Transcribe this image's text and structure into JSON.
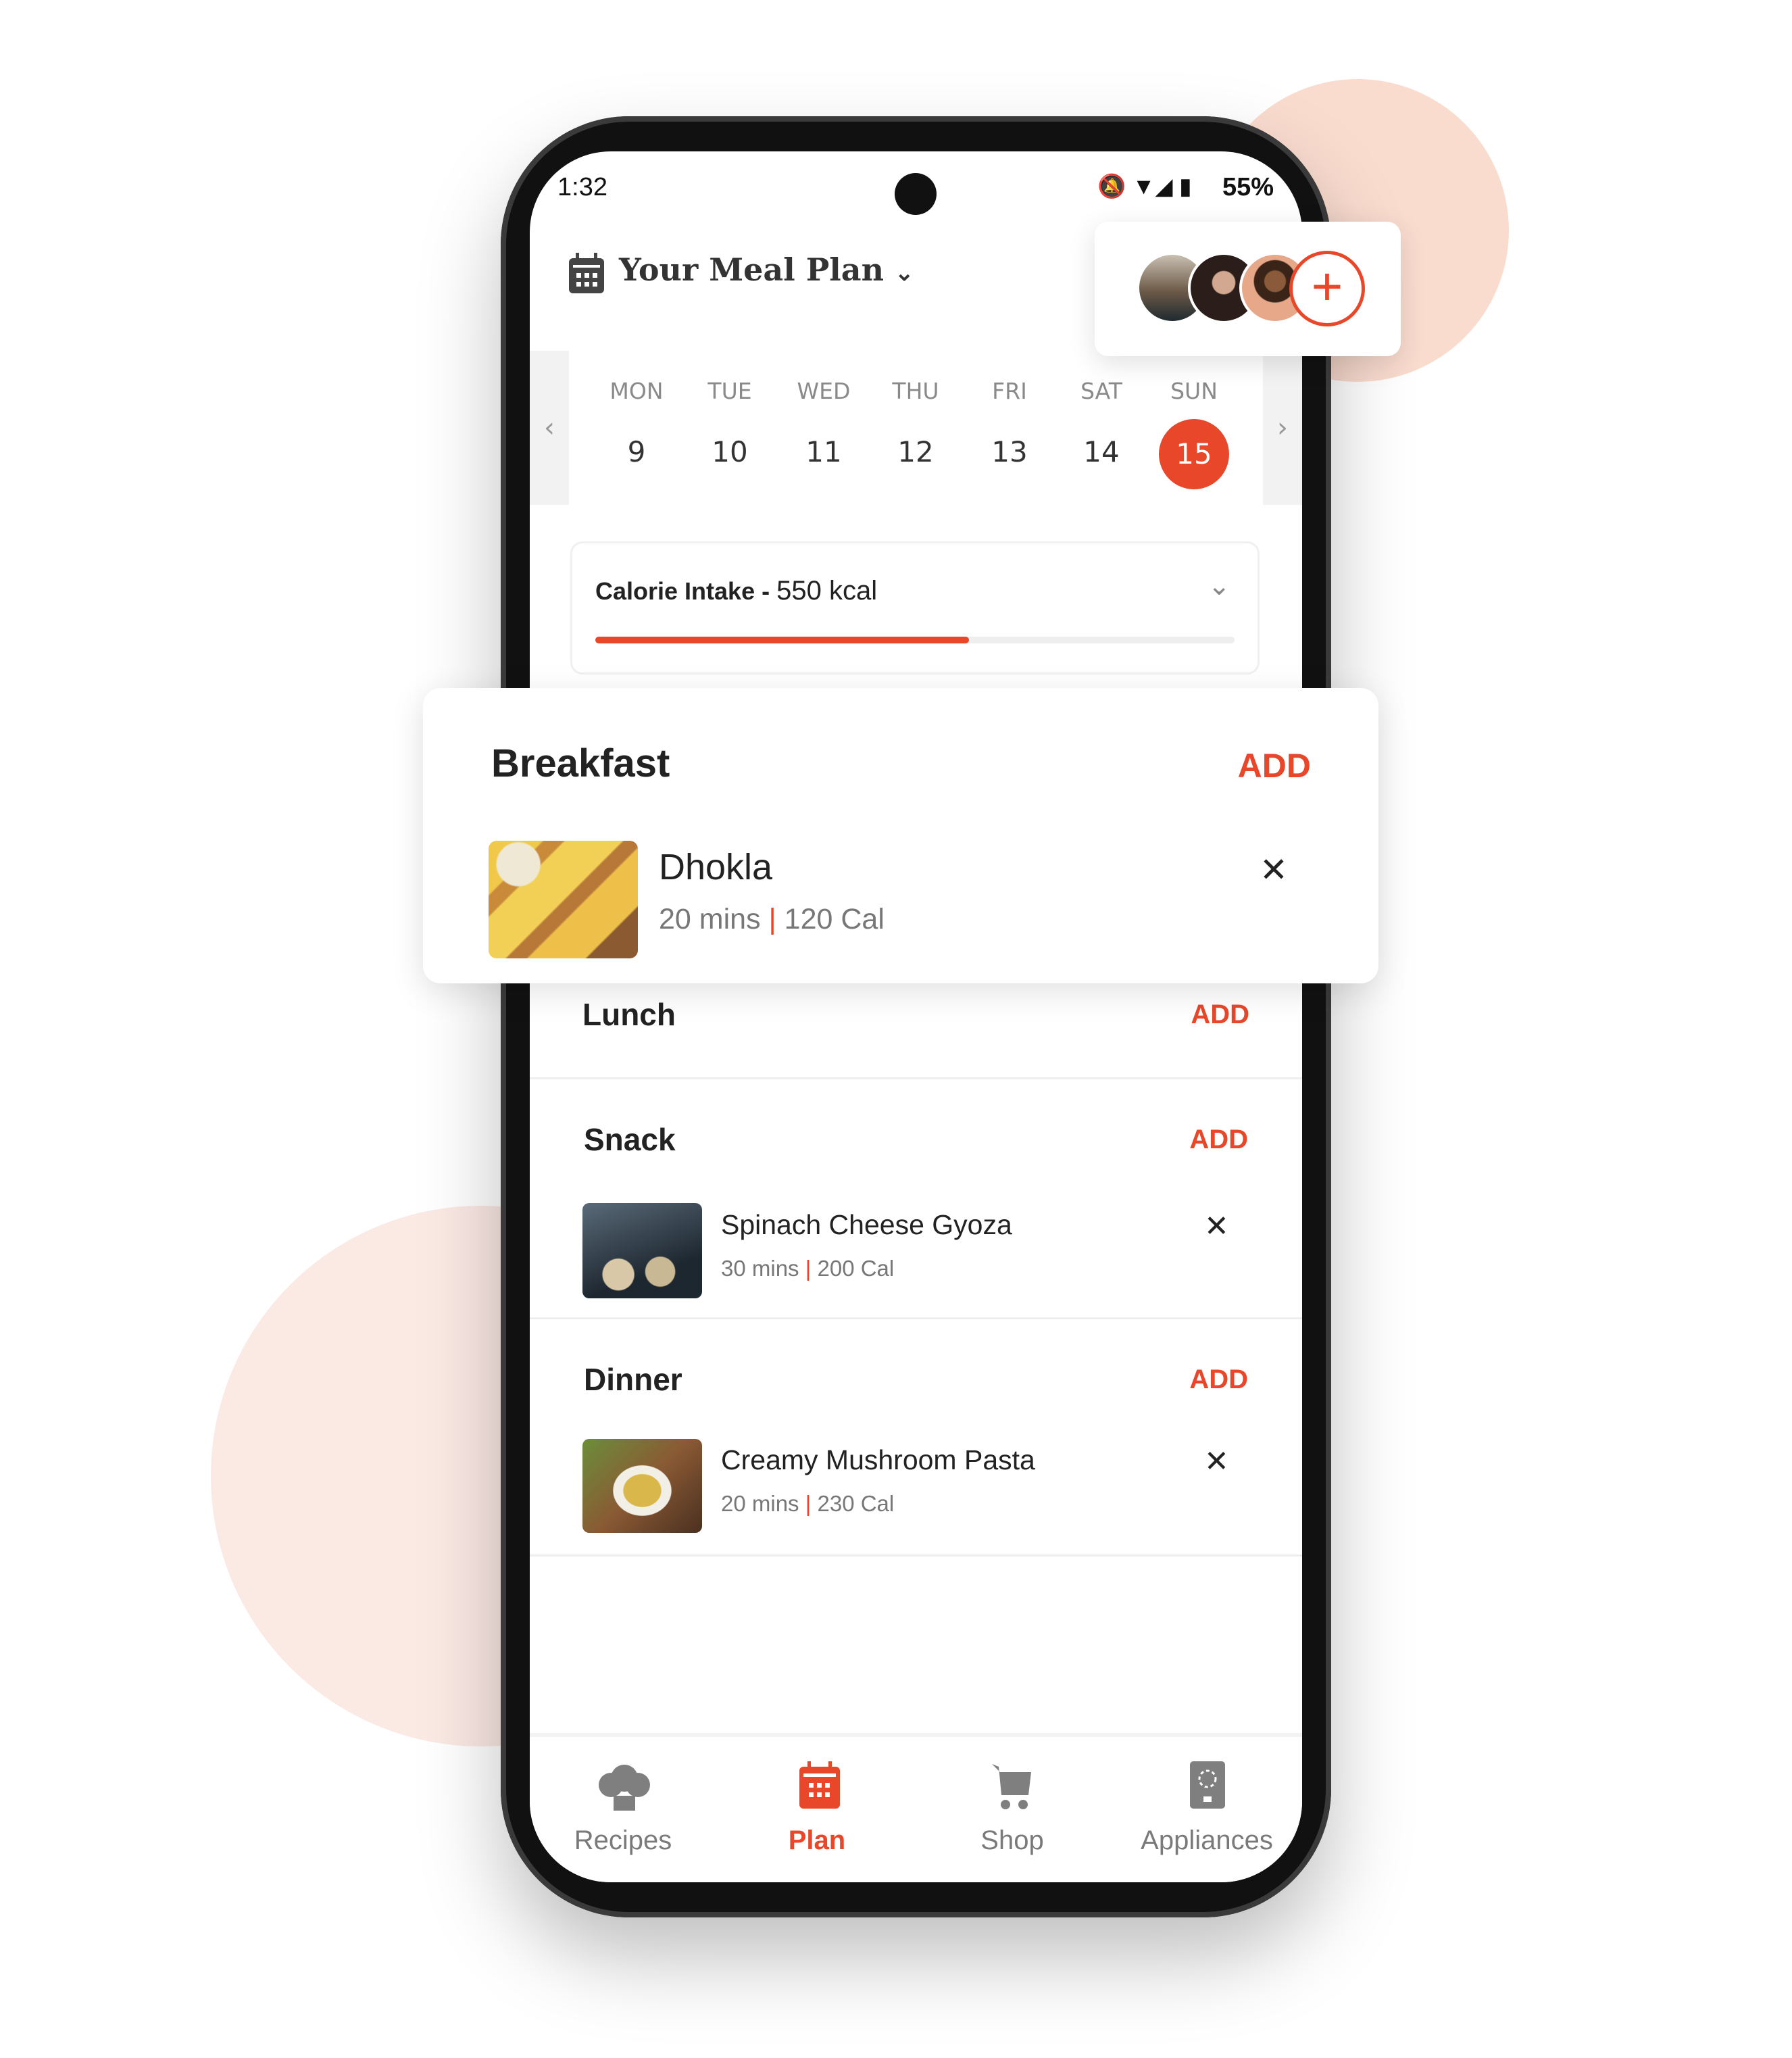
{
  "status_bar": {
    "time": "1:32",
    "battery": "55%",
    "icons": [
      "bell-off-icon",
      "wifi-icon",
      "signal-icon",
      "battery-icon"
    ]
  },
  "header": {
    "title": "Your Meal Plan",
    "icon": "calendar-icon"
  },
  "week": {
    "days": [
      {
        "label": "MON",
        "num": "9"
      },
      {
        "label": "TUE",
        "num": "10"
      },
      {
        "label": "WED",
        "num": "11"
      },
      {
        "label": "THU",
        "num": "12"
      },
      {
        "label": "FRI",
        "num": "13"
      },
      {
        "label": "SAT",
        "num": "14"
      },
      {
        "label": "SUN",
        "num": "15"
      }
    ],
    "selected": "15"
  },
  "calorie": {
    "label": "Calorie Intake",
    "sep": "-",
    "value": "550 kcal",
    "progress_percent": 58.5
  },
  "breakfast": {
    "title": "Breakfast",
    "add": "ADD",
    "item": {
      "name": "Dhokla",
      "time": "20 mins",
      "cal": "120 Cal"
    }
  },
  "lunch": {
    "title": "Lunch",
    "add": "ADD"
  },
  "snack": {
    "title": "Snack",
    "add": "ADD",
    "item": {
      "name": "Spinach Cheese Gyoza",
      "time": "30 mins",
      "cal": "200 Cal"
    }
  },
  "dinner": {
    "title": "Dinner",
    "add": "ADD",
    "item": {
      "name": "Creamy Mushroom Pasta",
      "time": "20 mins",
      "cal": "230 Cal"
    }
  },
  "nav": [
    {
      "label": "Recipes",
      "icon": "chef-hat-icon"
    },
    {
      "label": "Plan",
      "icon": "calendar-icon",
      "active": true
    },
    {
      "label": "Shop",
      "icon": "cart-icon"
    },
    {
      "label": "Appliances",
      "icon": "appliance-icon"
    }
  ],
  "colors": {
    "accent": "#e8472a",
    "bg_blob": "#fbe3d9"
  }
}
